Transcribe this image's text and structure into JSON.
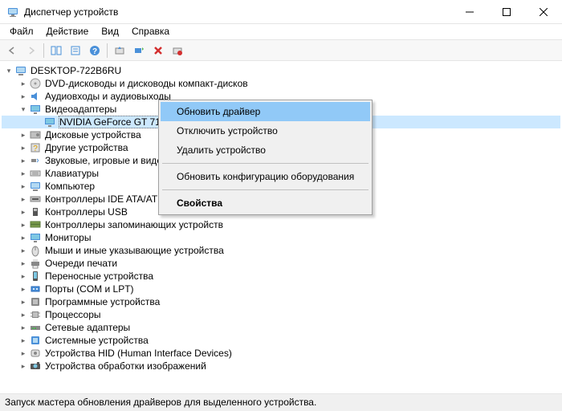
{
  "window": {
    "title": "Диспетчер устройств"
  },
  "menu": {
    "file": "Файл",
    "action": "Действие",
    "view": "Вид",
    "help": "Справка"
  },
  "tree": {
    "root": "DESKTOP-722B6RU",
    "items": [
      "DVD-дисководы и дисководы компакт-дисков",
      "Аудиовходы и аудиовыходы",
      "Видеоадаптеры",
      "Дисковые устройства",
      "Другие устройства",
      "Звуковые, игровые и виде",
      "Клавиатуры",
      "Компьютер",
      "Контроллеры IDE ATA/AT",
      "Контроллеры USB",
      "Контроллеры запоминающих устройств",
      "Мониторы",
      "Мыши и иные указывающие устройства",
      "Очереди печати",
      "Переносные устройства",
      "Порты (COM и LPT)",
      "Программные устройства",
      "Процессоры",
      "Сетевые адаптеры",
      "Системные устройства",
      "Устройства HID (Human Interface Devices)",
      "Устройства обработки изображений"
    ],
    "selected_child": "NVIDIA GeForce GT 710"
  },
  "context": {
    "update": "Обновить драйвер",
    "disable": "Отключить устройство",
    "uninstall": "Удалить устройство",
    "scan": "Обновить конфигурацию оборудования",
    "props": "Свойства"
  },
  "status": "Запуск мастера обновления драйверов для выделенного устройства."
}
